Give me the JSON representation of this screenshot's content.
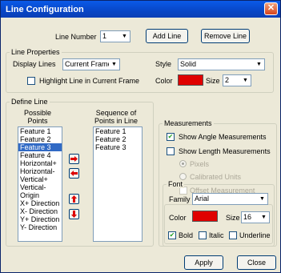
{
  "window": {
    "title": "Line Configuration",
    "close_glyph": "✕"
  },
  "top": {
    "line_number_label": "Line Number",
    "line_number_value": "1",
    "add_line": "Add Line",
    "remove_line": "Remove Line"
  },
  "line_properties": {
    "title": "Line Properties",
    "display_lines_label": "Display Lines",
    "display_lines_value": "Current Frame",
    "style_label": "Style",
    "style_value": "Solid",
    "highlight_label": "Highlight Line in Current Frame",
    "highlight_checked": false,
    "color_label": "Color",
    "color_value": "#e00000",
    "size_label": "Size",
    "size_value": "2"
  },
  "define_line": {
    "title": "Define Line",
    "possible_points_header": "Possible\nPoints",
    "sequence_header": "Sequence of\nPoints in Line",
    "possible_points": [
      "Feature 1",
      "Feature 2",
      "Feature 3",
      "Feature 4",
      "Horizontal+",
      "Horizontal-",
      "Vertical+",
      "Vertical-",
      "Origin",
      "X+ Direction",
      "X- Direction",
      "Y+ Direction",
      "Y- Direction"
    ],
    "selected_index": 2,
    "sequence_points": [
      "Feature 1",
      "Feature 2",
      "Feature 3"
    ]
  },
  "measurements": {
    "title": "Measurements",
    "show_angle_label": "Show Angle Measurements",
    "show_angle_checked": true,
    "show_length_label": "Show Length Measurements",
    "show_length_checked": false,
    "pixels_label": "Pixels",
    "calibrated_label": "Calibrated Units",
    "offset_label": "Offset Measurement"
  },
  "font": {
    "title": "Font",
    "family_label": "Family",
    "family_value": "Arial",
    "color_label": "Color",
    "color_value": "#e00000",
    "size_label": "Size",
    "size_value": "16",
    "bold_label": "Bold",
    "bold_checked": true,
    "italic_label": "Italic",
    "underline_label": "Underline"
  },
  "footer": {
    "apply": "Apply",
    "close": "Close"
  }
}
